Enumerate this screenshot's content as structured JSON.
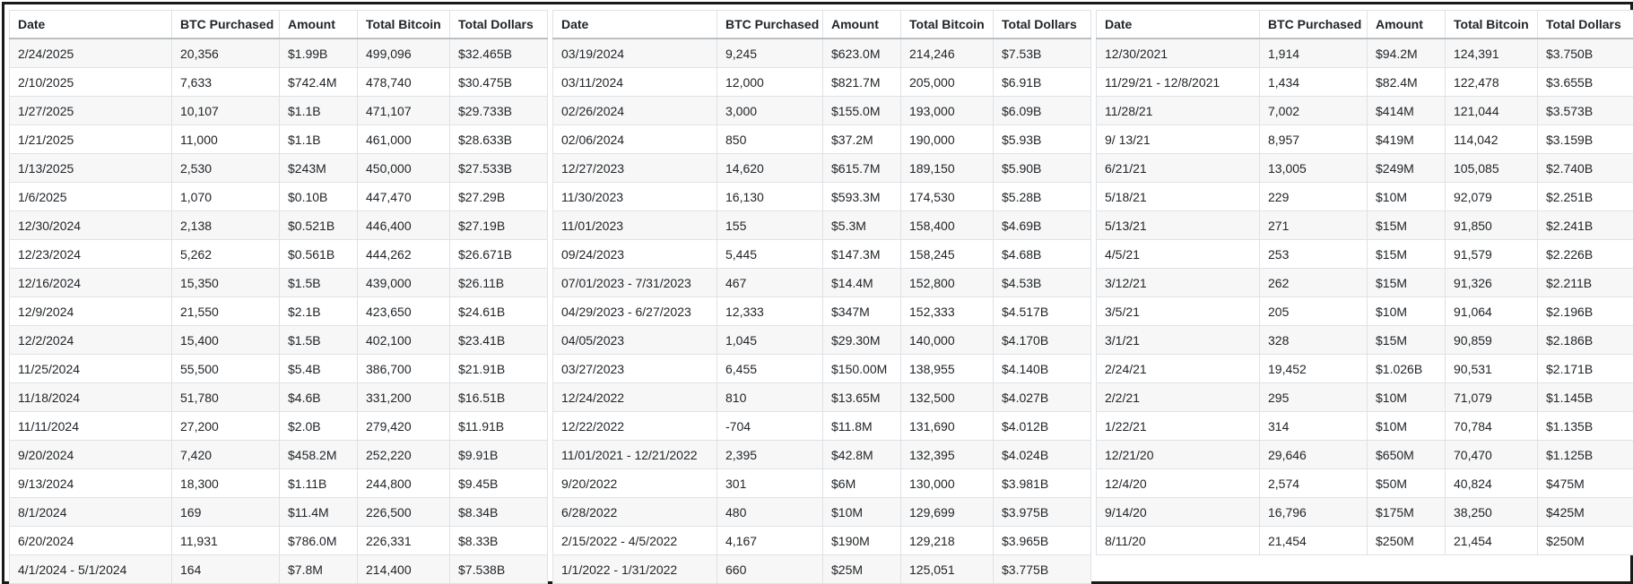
{
  "headers": [
    "Date",
    "BTC Purchased",
    "Amount",
    "Total Bitcoin",
    "Total Dollars"
  ],
  "panels": [
    {
      "rows": [
        [
          "2/24/2025",
          "20,356",
          "$1.99B",
          "499,096",
          "$32.465B"
        ],
        [
          "2/10/2025",
          "7,633",
          "$742.4M",
          "478,740",
          "$30.475B"
        ],
        [
          "1/27/2025",
          "10,107",
          "$1.1B",
          "471,107",
          "$29.733B"
        ],
        [
          "1/21/2025",
          "11,000",
          "$1.1B",
          "461,000",
          "$28.633B"
        ],
        [
          "1/13/2025",
          "2,530",
          "$243M",
          "450,000",
          "$27.533B"
        ],
        [
          "1/6/2025",
          "1,070",
          "$0.10B",
          "447,470",
          "$27.29B"
        ],
        [
          "12/30/2024",
          "2,138",
          "$0.521B",
          "446,400",
          "$27.19B"
        ],
        [
          "12/23/2024",
          "5,262",
          "$0.561B",
          "444,262",
          "$26.671B"
        ],
        [
          "12/16/2024",
          "15,350",
          "$1.5B",
          "439,000",
          "$26.11B"
        ],
        [
          "12/9/2024",
          "21,550",
          "$2.1B",
          "423,650",
          "$24.61B"
        ],
        [
          "12/2/2024",
          "15,400",
          "$1.5B",
          "402,100",
          "$23.41B"
        ],
        [
          "11/25/2024",
          "55,500",
          "$5.4B",
          "386,700",
          "$21.91B"
        ],
        [
          "11/18/2024",
          "51,780",
          "$4.6B",
          "331,200",
          "$16.51B"
        ],
        [
          "11/11/2024",
          "27,200",
          "$2.0B",
          "279,420",
          "$11.91B"
        ],
        [
          "9/20/2024",
          "7,420",
          "$458.2M",
          "252,220",
          "$9.91B"
        ],
        [
          "9/13/2024",
          "18,300",
          "$1.11B",
          "244,800",
          "$9.45B"
        ],
        [
          "8/1/2024",
          "169",
          "$11.4M",
          "226,500",
          "$8.34B"
        ],
        [
          "6/20/2024",
          "11,931",
          "$786.0M",
          "226,331",
          "$8.33B"
        ],
        [
          "4/1/2024 - 5/1/2024",
          "164",
          "$7.8M",
          "214,400",
          "$7.538B"
        ]
      ]
    },
    {
      "rows": [
        [
          "03/19/2024",
          "9,245",
          "$623.0M",
          "214,246",
          "$7.53B"
        ],
        [
          "03/11/2024",
          "12,000",
          "$821.7M",
          "205,000",
          "$6.91B"
        ],
        [
          "02/26/2024",
          "3,000",
          "$155.0M",
          "193,000",
          "$6.09B"
        ],
        [
          "02/06/2024",
          "850",
          "$37.2M",
          "190,000",
          "$5.93B"
        ],
        [
          "12/27/2023",
          "14,620",
          "$615.7M",
          "189,150",
          "$5.90B"
        ],
        [
          "11/30/2023",
          "16,130",
          "$593.3M",
          "174,530",
          "$5.28B"
        ],
        [
          "11/01/2023",
          "155",
          "$5.3M",
          "158,400",
          "$4.69B"
        ],
        [
          "09/24/2023",
          "5,445",
          "$147.3M",
          "158,245",
          "$4.68B"
        ],
        [
          "07/01/2023 - 7/31/2023",
          "467",
          "$14.4M",
          "152,800",
          "$4.53B"
        ],
        [
          "04/29/2023 - 6/27/2023",
          "12,333",
          "$347M",
          "152,333",
          "$4.517B"
        ],
        [
          "04/05/2023",
          "1,045",
          "$29.30M",
          "140,000",
          "$4.170B"
        ],
        [
          "03/27/2023",
          "6,455",
          "$150.00M",
          "138,955",
          "$4.140B"
        ],
        [
          "12/24/2022",
          "810",
          "$13.65M",
          "132,500",
          "$4.027B"
        ],
        [
          "12/22/2022",
          "-704",
          "$11.8M",
          "131,690",
          "$4.012B"
        ],
        [
          "11/01/2021 - 12/21/2022",
          "2,395",
          "$42.8M",
          "132,395",
          "$4.024B"
        ],
        [
          "9/20/2022",
          "301",
          "$6M",
          "130,000",
          "$3.981B"
        ],
        [
          "6/28/2022",
          "480",
          "$10M",
          "129,699",
          "$3.975B"
        ],
        [
          "2/15/2022 - 4/5/2022",
          "4,167",
          "$190M",
          "129,218",
          "$3.965B"
        ],
        [
          "1/1/2022 - 1/31/2022",
          "660",
          "$25M",
          "125,051",
          "$3.775B"
        ]
      ]
    },
    {
      "rows": [
        [
          "12/30/2021",
          "1,914",
          "$94.2M",
          "124,391",
          "$3.750B"
        ],
        [
          "11/29/21 - 12/8/2021",
          "1,434",
          "$82.4M",
          "122,478",
          "$3.655B"
        ],
        [
          "11/28/21",
          "7,002",
          "$414M",
          "121,044",
          "$3.573B"
        ],
        [
          "9/ 13/21",
          "8,957",
          "$419M",
          "114,042",
          "$3.159B"
        ],
        [
          "6/21/21",
          "13,005",
          "$249M",
          "105,085",
          "$2.740B"
        ],
        [
          "5/18/21",
          "229",
          "$10M",
          "92,079",
          "$2.251B"
        ],
        [
          "5/13/21",
          "271",
          "$15M",
          "91,850",
          "$2.241B"
        ],
        [
          "4/5/21",
          "253",
          "$15M",
          "91,579",
          "$2.226B"
        ],
        [
          "3/12/21",
          "262",
          "$15M",
          "91,326",
          "$2.211B"
        ],
        [
          "3/5/21",
          "205",
          "$10M",
          "91,064",
          "$2.196B"
        ],
        [
          "3/1/21",
          "328",
          "$15M",
          "90,859",
          "$2.186B"
        ],
        [
          "2/24/21",
          "19,452",
          "$1.026B",
          "90,531",
          "$2.171B"
        ],
        [
          "2/2/21",
          "295",
          "$10M",
          "71,079",
          "$1.145B"
        ],
        [
          "1/22/21",
          "314",
          "$10M",
          "70,784",
          "$1.135B"
        ],
        [
          "12/21/20",
          "29,646",
          "$650M",
          "70,470",
          "$1.125B"
        ],
        [
          "12/4/20",
          "2,574",
          "$50M",
          "40,824",
          "$475M"
        ],
        [
          "9/14/20",
          "16,796",
          "$175M",
          "38,250",
          "$425M"
        ],
        [
          "8/11/20",
          "21,454",
          "$250M",
          "21,454",
          "$250M"
        ]
      ]
    }
  ]
}
